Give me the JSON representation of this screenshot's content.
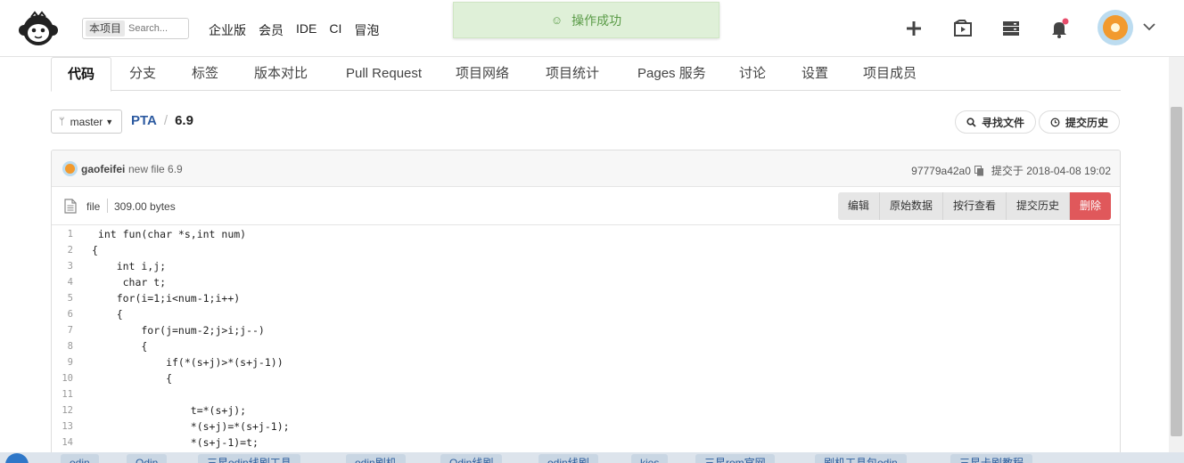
{
  "topbar": {
    "search_scope": "本项目",
    "search_placeholder": "Search...",
    "nav": [
      "企业版",
      "会员",
      "IDE",
      "CI",
      "冒泡"
    ]
  },
  "toast": {
    "icon": "smile-icon",
    "text": "操作成功"
  },
  "tabs": [
    {
      "label": "代码",
      "active": true
    },
    {
      "label": "分支"
    },
    {
      "label": "标签"
    },
    {
      "label": "版本对比"
    },
    {
      "label": "Pull Request"
    },
    {
      "label": "项目网络"
    },
    {
      "label": "项目统计"
    },
    {
      "label": "Pages 服务"
    },
    {
      "label": "讨论"
    },
    {
      "label": "设置"
    },
    {
      "label": "项目成员"
    }
  ],
  "branch": {
    "name": "master"
  },
  "breadcrumb": {
    "repo": "PTA",
    "separator": "/",
    "file": "6.9"
  },
  "actions": {
    "find_file": "寻找文件",
    "history": "提交历史"
  },
  "commit": {
    "user": "gaofeifei",
    "message": "new file 6.9",
    "hash": "97779a42a0",
    "time": "提交于 2018-04-08 19:02"
  },
  "file": {
    "type": "file",
    "size": "309.00 bytes",
    "buttons": [
      "编辑",
      "原始数据",
      "按行查看",
      "提交历史",
      "删除"
    ]
  },
  "code_lines": [
    {
      "n": "1",
      "text": " int fun(char *s,int num)"
    },
    {
      "n": "2",
      "text": "{"
    },
    {
      "n": "3",
      "text": "    int i,j;"
    },
    {
      "n": "4",
      "text": "     char t;"
    },
    {
      "n": "5",
      "text": "    for(i=1;i<num-1;i++)"
    },
    {
      "n": "6",
      "text": "    {"
    },
    {
      "n": "7",
      "text": "        for(j=num-2;j>i;j--)"
    },
    {
      "n": "8",
      "text": "        {"
    },
    {
      "n": "9",
      "text": "            if(*(s+j)>*(s+j-1))"
    },
    {
      "n": "10",
      "text": "            {"
    },
    {
      "n": "11",
      "text": ""
    },
    {
      "n": "12",
      "text": "                t=*(s+j);"
    },
    {
      "n": "13",
      "text": "                *(s+j)=*(s+j-1);"
    },
    {
      "n": "14",
      "text": "                *(s+j-1)=t;"
    }
  ],
  "bottom_bar": [
    "odin",
    "Odin",
    "三星odin线刷工具",
    "odin刷机",
    "Odin线刷",
    "odin线刷",
    "kies",
    "三星rom官网",
    "刷机工具包odin",
    "三星卡刷教程"
  ]
}
